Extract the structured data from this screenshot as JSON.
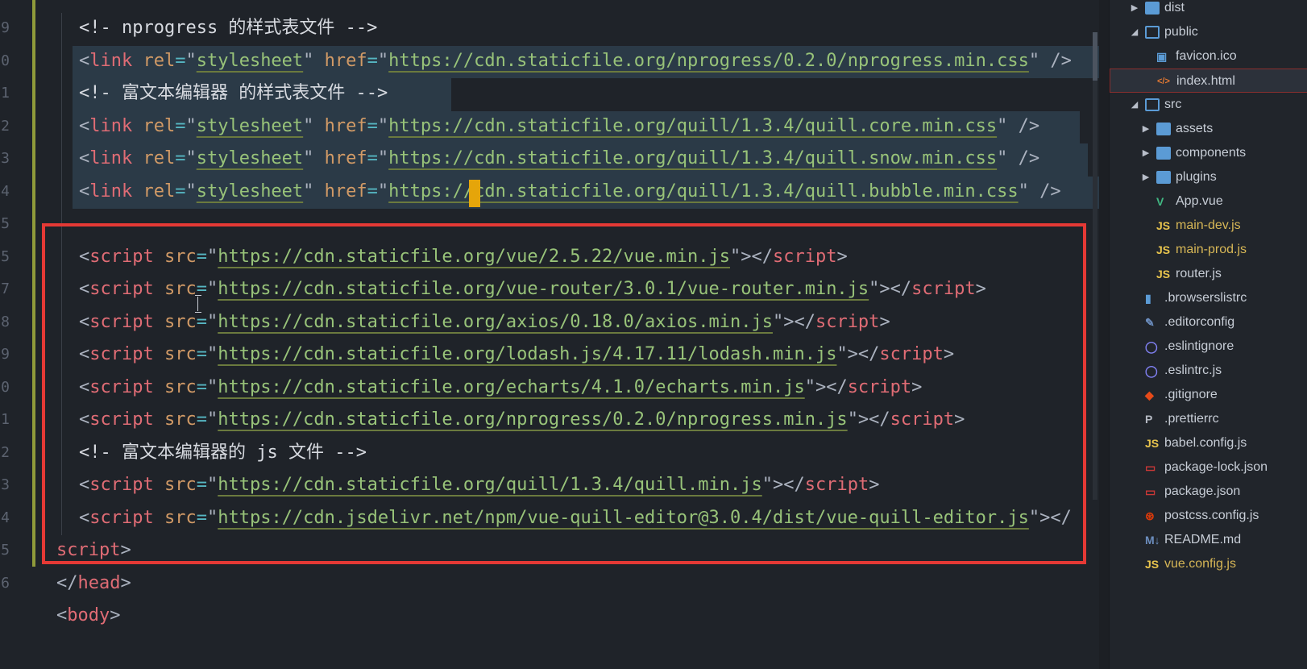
{
  "editor": {
    "line_numbers": [
      "9",
      "0",
      "1",
      "2",
      "3",
      "4",
      "5",
      "5",
      "7",
      "8",
      "9",
      "0",
      "1",
      "2",
      "3",
      "4",
      "5",
      "6"
    ],
    "lines": [
      {
        "tokens": [
          [
            "cmt",
            "<!- nprogress 的样式表文件 -->"
          ]
        ]
      },
      {
        "tokens": [
          [
            "pun",
            "<"
          ],
          [
            "tag",
            "link"
          ],
          [
            "attr",
            " rel"
          ],
          [
            "eq",
            "="
          ],
          [
            "pun",
            "\""
          ],
          [
            "str",
            "stylesheet"
          ],
          [
            "pun",
            "\""
          ],
          [
            "attr",
            " href"
          ],
          [
            "eq",
            "="
          ],
          [
            "pun",
            "\""
          ],
          [
            "str",
            "https://cdn.staticfile.org/nprogress/0.2.0/nprogress.min.css"
          ],
          [
            "pun",
            "\" />"
          ]
        ]
      },
      {
        "tokens": [
          [
            "cmt",
            "<!- 富文本编辑器 的样式表文件 -->"
          ]
        ]
      },
      {
        "tokens": [
          [
            "pun",
            "<"
          ],
          [
            "tag",
            "link"
          ],
          [
            "attr",
            " rel"
          ],
          [
            "eq",
            "="
          ],
          [
            "pun",
            "\""
          ],
          [
            "str",
            "stylesheet"
          ],
          [
            "pun",
            "\""
          ],
          [
            "attr",
            " href"
          ],
          [
            "eq",
            "="
          ],
          [
            "pun",
            "\""
          ],
          [
            "str",
            "https://cdn.staticfile.org/quill/1.3.4/quill.core.min.css"
          ],
          [
            "pun",
            "\" />"
          ]
        ]
      },
      {
        "tokens": [
          [
            "pun",
            "<"
          ],
          [
            "tag",
            "link"
          ],
          [
            "attr",
            " rel"
          ],
          [
            "eq",
            "="
          ],
          [
            "pun",
            "\""
          ],
          [
            "str",
            "stylesheet"
          ],
          [
            "pun",
            "\""
          ],
          [
            "attr",
            " href"
          ],
          [
            "eq",
            "="
          ],
          [
            "pun",
            "\""
          ],
          [
            "str",
            "https://cdn.staticfile.org/quill/1.3.4/quill.snow.min.css"
          ],
          [
            "pun",
            "\" />"
          ]
        ]
      },
      {
        "tokens": [
          [
            "pun",
            "<"
          ],
          [
            "tag",
            "link"
          ],
          [
            "attr",
            " rel"
          ],
          [
            "eq",
            "="
          ],
          [
            "pun",
            "\""
          ],
          [
            "str",
            "stylesheet"
          ],
          [
            "pun",
            "\""
          ],
          [
            "attr",
            " href"
          ],
          [
            "eq",
            "="
          ],
          [
            "pun",
            "\""
          ],
          [
            "str",
            "https://cdn.staticfile.org/quill/1.3.4/quill.bubble.min.css"
          ],
          [
            "pun",
            "\" />"
          ]
        ]
      },
      {
        "tokens": []
      },
      {
        "tokens": [
          [
            "pun",
            "<"
          ],
          [
            "tag",
            "script"
          ],
          [
            "attr",
            " src"
          ],
          [
            "eq",
            "="
          ],
          [
            "pun",
            "\""
          ],
          [
            "str",
            "https://cdn.staticfile.org/vue/2.5.22/vue.min.js"
          ],
          [
            "pun",
            "\"></"
          ],
          [
            "tag",
            "script"
          ],
          [
            "pun",
            ">"
          ]
        ]
      },
      {
        "tokens": [
          [
            "pun",
            "<"
          ],
          [
            "tag",
            "script"
          ],
          [
            "attr",
            " src"
          ],
          [
            "eq",
            "="
          ],
          [
            "pun",
            "\""
          ],
          [
            "str",
            "https://cdn.staticfile.org/vue-router/3.0.1/vue-router.min.js"
          ],
          [
            "pun",
            "\"></"
          ],
          [
            "tag",
            "script"
          ],
          [
            "pun",
            ">"
          ]
        ]
      },
      {
        "tokens": [
          [
            "pun",
            "<"
          ],
          [
            "tag",
            "script"
          ],
          [
            "attr",
            " src"
          ],
          [
            "eq",
            "="
          ],
          [
            "pun",
            "\""
          ],
          [
            "str",
            "https://cdn.staticfile.org/axios/0.18.0/axios.min.js"
          ],
          [
            "pun",
            "\"></"
          ],
          [
            "tag",
            "script"
          ],
          [
            "pun",
            ">"
          ]
        ]
      },
      {
        "tokens": [
          [
            "pun",
            "<"
          ],
          [
            "tag",
            "script"
          ],
          [
            "attr",
            " src"
          ],
          [
            "eq",
            "="
          ],
          [
            "pun",
            "\""
          ],
          [
            "str",
            "https://cdn.staticfile.org/lodash.js/4.17.11/lodash.min.js"
          ],
          [
            "pun",
            "\"></"
          ],
          [
            "tag",
            "script"
          ],
          [
            "pun",
            ">"
          ]
        ]
      },
      {
        "tokens": [
          [
            "pun",
            "<"
          ],
          [
            "tag",
            "script"
          ],
          [
            "attr",
            " src"
          ],
          [
            "eq",
            "="
          ],
          [
            "pun",
            "\""
          ],
          [
            "str",
            "https://cdn.staticfile.org/echarts/4.1.0/echarts.min.js"
          ],
          [
            "pun",
            "\"></"
          ],
          [
            "tag",
            "script"
          ],
          [
            "pun",
            ">"
          ]
        ]
      },
      {
        "tokens": [
          [
            "pun",
            "<"
          ],
          [
            "tag",
            "script"
          ],
          [
            "attr",
            " src"
          ],
          [
            "eq",
            "="
          ],
          [
            "pun",
            "\""
          ],
          [
            "str",
            "https://cdn.staticfile.org/nprogress/0.2.0/nprogress.min.js"
          ],
          [
            "pun",
            "\"></"
          ],
          [
            "tag",
            "script"
          ],
          [
            "pun",
            ">"
          ]
        ]
      },
      {
        "tokens": [
          [
            "cmt",
            "<!- 富文本编辑器的 js 文件 -->"
          ]
        ]
      },
      {
        "tokens": [
          [
            "pun",
            "<"
          ],
          [
            "tag",
            "script"
          ],
          [
            "attr",
            " src"
          ],
          [
            "eq",
            "="
          ],
          [
            "pun",
            "\""
          ],
          [
            "str",
            "https://cdn.staticfile.org/quill/1.3.4/quill.min.js"
          ],
          [
            "pun",
            "\"></"
          ],
          [
            "tag",
            "script"
          ],
          [
            "pun",
            ">"
          ]
        ]
      },
      {
        "tokens": [
          [
            "pun",
            "<"
          ],
          [
            "tag",
            "script"
          ],
          [
            "attr",
            " src"
          ],
          [
            "eq",
            "="
          ],
          [
            "pun",
            "\""
          ],
          [
            "str",
            "https://cdn.jsdelivr.net/npm/vue-quill-editor@3.0.4/dist/vue-quill-editor.js"
          ],
          [
            "pun",
            "\"></"
          ]
        ]
      },
      {
        "tokens": [
          [
            "tag",
            "script"
          ],
          [
            "pun",
            ">"
          ]
        ]
      },
      {
        "tokens": [
          [
            "pun",
            "</"
          ],
          [
            "tag",
            "head"
          ],
          [
            "pun",
            ">"
          ]
        ]
      },
      {
        "tokens": [
          [
            "pun",
            "<"
          ],
          [
            "tag",
            "body"
          ],
          [
            "pun",
            ">"
          ]
        ]
      }
    ],
    "cursor": {
      "line": 5,
      "after_text": "https://"
    }
  },
  "explorer": {
    "items": [
      {
        "name": "dist",
        "kind": "folder",
        "state": "closed",
        "depth": 0
      },
      {
        "name": "public",
        "kind": "folder",
        "state": "open",
        "depth": 0
      },
      {
        "name": "favicon.ico",
        "kind": "image",
        "depth": 1
      },
      {
        "name": "index.html",
        "kind": "html",
        "depth": 1,
        "active": true
      },
      {
        "name": "src",
        "kind": "folder",
        "state": "open",
        "depth": 0
      },
      {
        "name": "assets",
        "kind": "folder",
        "state": "closed",
        "depth": 1
      },
      {
        "name": "components",
        "kind": "folder",
        "state": "closed",
        "depth": 1
      },
      {
        "name": "plugins",
        "kind": "folder",
        "state": "closed",
        "depth": 1
      },
      {
        "name": "App.vue",
        "kind": "vue",
        "depth": 1
      },
      {
        "name": "main-dev.js",
        "kind": "js",
        "depth": 1,
        "color": "#d6b656"
      },
      {
        "name": "main-prod.js",
        "kind": "js",
        "depth": 1,
        "color": "#d6b656"
      },
      {
        "name": "router.js",
        "kind": "js",
        "depth": 1
      },
      {
        "name": ".browserslistrc",
        "kind": "file",
        "depth": 0
      },
      {
        "name": ".editorconfig",
        "kind": "editorconfig",
        "depth": 0
      },
      {
        "name": ".eslintignore",
        "kind": "eslint",
        "depth": 0
      },
      {
        "name": ".eslintrc.js",
        "kind": "eslint",
        "depth": 0
      },
      {
        "name": ".gitignore",
        "kind": "git",
        "depth": 0
      },
      {
        "name": ".prettierrc",
        "kind": "prettier",
        "depth": 0
      },
      {
        "name": "babel.config.js",
        "kind": "js",
        "depth": 0
      },
      {
        "name": "package-lock.json",
        "kind": "npm",
        "depth": 0
      },
      {
        "name": "package.json",
        "kind": "npm",
        "depth": 0
      },
      {
        "name": "postcss.config.js",
        "kind": "postcss",
        "depth": 0
      },
      {
        "name": "README.md",
        "kind": "md",
        "depth": 0
      },
      {
        "name": "vue.config.js",
        "kind": "js",
        "depth": 0,
        "color": "#d6b656"
      }
    ]
  },
  "colors": {
    "highlight_box": "#e53935",
    "cursor": "#e5a50a",
    "folder": "#5b9bd5"
  }
}
